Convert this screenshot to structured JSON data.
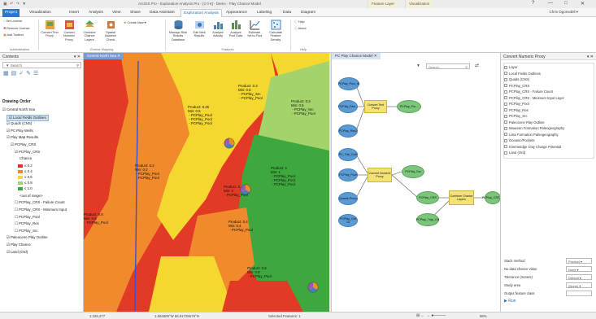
{
  "titlebar": {
    "quick_access": "▣ ↶ ↷ ▼",
    "title": "ArcGIS Pro - Exploration Analysis Pro - [2 0 €] - Demo - Play Chance Model",
    "context_tab_1": "Feature Layer",
    "context_tab_2": "Visualization",
    "help": "?",
    "minimize": "—",
    "maximize": "□",
    "close": "✕"
  },
  "tabs": [
    "Project",
    "Visualization",
    "Insert",
    "Analysis",
    "View",
    "Share",
    "Data Assistant",
    "Exploration Analysis",
    "Appearance",
    "Labeling",
    "Data",
    "Diagram"
  ],
  "user": "Chris Ogonsdell ▾",
  "ribbon": {
    "admin": {
      "items": [
        "Set License",
        "Remove License",
        "Add Toolbox"
      ],
      "title": "Administration"
    },
    "chance": {
      "buttons": [
        "Convert Text Proxy",
        "Convert Numeric Proxy",
        "Combine Chance Layers",
        "Spatial Balance Check"
      ],
      "create_new": "Create New ▾",
      "title": "Chance Mapping"
    },
    "features": {
      "buttons": [
        "Manage Risk Results Database",
        "Edit Well Results",
        "Analyze Activity",
        "Analyze Pool Data",
        "Estimate Yet-to-Find",
        "Calculate Feature Density"
      ],
      "title": "Features"
    },
    "help": {
      "items": [
        "Help",
        "About"
      ],
      "title": "Help"
    }
  },
  "contents": {
    "title": "Contents",
    "pin": "▾ ✕",
    "search_placeholder": "Search",
    "drawing_order": "Drawing Order",
    "layers": [
      {
        "label": "Central North Sea",
        "indent": 0,
        "check": "☑"
      },
      {
        "label": "Local Fields Outlines",
        "indent": 1,
        "check": "☑",
        "selected": true
      },
      {
        "label": "Quads (CNS)",
        "indent": 1,
        "check": "☑"
      },
      {
        "label": "PC Play Wells",
        "indent": 1,
        "check": "☑"
      },
      {
        "label": "Play Map Results",
        "indent": 1,
        "check": "☑"
      },
      {
        "label": "PCPlay_CRS",
        "indent": 2,
        "check": "☑"
      },
      {
        "label": "PCPlay_CRS",
        "indent": 3,
        "check": "☑"
      },
      {
        "label": "Chance",
        "indent": 4,
        "check": ""
      }
    ],
    "legend": [
      {
        "label": "≤ 0.2",
        "color": "#e0301e"
      },
      {
        "label": "≤ 0.4",
        "color": "#f08a2c"
      },
      {
        "label": "≤ 0.6",
        "color": "#f5d82f"
      },
      {
        "label": "≤ 0.8",
        "color": "#a4d36b"
      },
      {
        "label": "≤ 1.0",
        "color": "#3ea83e"
      }
    ],
    "layers2": [
      {
        "label": "<out of range>",
        "indent": 4,
        "check": ""
      },
      {
        "label": "PCPlay_CRS - Failure Count",
        "indent": 3,
        "check": "☐"
      },
      {
        "label": "PCPlay_CRS - Minimum Input",
        "indent": 3,
        "check": "☐"
      },
      {
        "label": "PCPlay_Pool",
        "indent": 3,
        "check": "☐"
      },
      {
        "label": "PCPlay_Res",
        "indent": 3,
        "check": "☐"
      },
      {
        "label": "PCPlay_Src",
        "indent": 3,
        "check": "☐"
      },
      {
        "label": "Paleocene Play Outline",
        "indent": 1,
        "check": "☑"
      },
      {
        "label": "Play Chance",
        "indent": 1,
        "check": "☑"
      },
      {
        "label": "Land (Ord)",
        "indent": 1,
        "check": "☑"
      }
    ]
  },
  "map": {
    "tab": "Central North Sea ✕",
    "labels": [
      "Product: 0.3\nMin: 0.5\n - PCPlay_Src\n - PCPlay_Pool",
      "Product: 0.25\nMin: 0.5\n - PCPlay_Pool\n - PCPlay_Pool\n - PCPlay_Pool",
      "Product: 0.3\nMin: 0.5\n - PCPlay_Src\n - PCPlay_Pool",
      "Product: 0.2\nMin: 0.2\n - PCPlay_Pool\n - PCPlay_Pool",
      "Product: 0.8\nMin: 0.8\n - PCPlay_Pool",
      "Product: 1\nMin: 1\n - PCPlay_Pool\n - PCPlay_Pool\n - PCPlay_Pool",
      "Product: 0\nMin: 0\n - PCPlay_Pool",
      "Product: 0.4\nMin: 0.4\n - PCPlay_Pool",
      "Product: 0.8\nMin: 0.8\n - PCPlay_Pool"
    ]
  },
  "model": {
    "tab": "PC Play Chance Model ✕",
    "search_placeholder": "Search...",
    "nodes": {
      "b1": "PCPlay_Pool_IN",
      "b2": "PCPlay_Res...",
      "b3": "PCPlay_Res2",
      "b4": "PC_Trib_Cuttt",
      "b5": "PCPlay_Pool",
      "b6": "Quants Proxy",
      "b7": "PCPlay_Grd 13",
      "y1": "Convert Text Proxy",
      "y2": "Convert Numeric Proxy",
      "y3": "Combine Chance Layers",
      "g1": "PCPlay_Pro...",
      "g2": "PCPlay_Src",
      "g3": "PCPlay_CRS",
      "g4": "PCPlay_Trap_CH",
      "g5": "PCPlay_CRS_C"
    }
  },
  "tool": {
    "title": "Convert Numeric Proxy",
    "pin": "▾ ✕",
    "list": [
      "Layer",
      "Local Fields Outlines",
      "Quads (CNS)",
      "PCPlay_CRS",
      "PCPlay_CRS - Failure Count",
      "PCPlay_CRS - Minimum Input Layer",
      "PCPlay_Pool",
      "PCPlay_Res",
      "PCPlay_Src",
      "Paleocene Play Outline",
      "Maureen Formation Paleogeography",
      "Lista Formation Paleogeography",
      "Oceanic/Pockets",
      "Kimmeridge Clay Charge Potential",
      "Land (Ord)"
    ],
    "params": [
      {
        "label": "Stack method",
        "value": "Product ▾"
      },
      {
        "label": "No data chance value",
        "value": "None ▾"
      },
      {
        "label": "Tolerance (meters)",
        "value": "Default ▾"
      },
      {
        "label": "Study area",
        "value": "(None) ▾"
      },
      {
        "label": "Output feature class",
        "value": ""
      }
    ],
    "run": "▶ Run"
  },
  "status": {
    "scale": "1:226,277",
    "coords": "1.564609°W 56.91725679°N",
    "selected": "Selected Features: 1",
    "zoom": "96%"
  }
}
